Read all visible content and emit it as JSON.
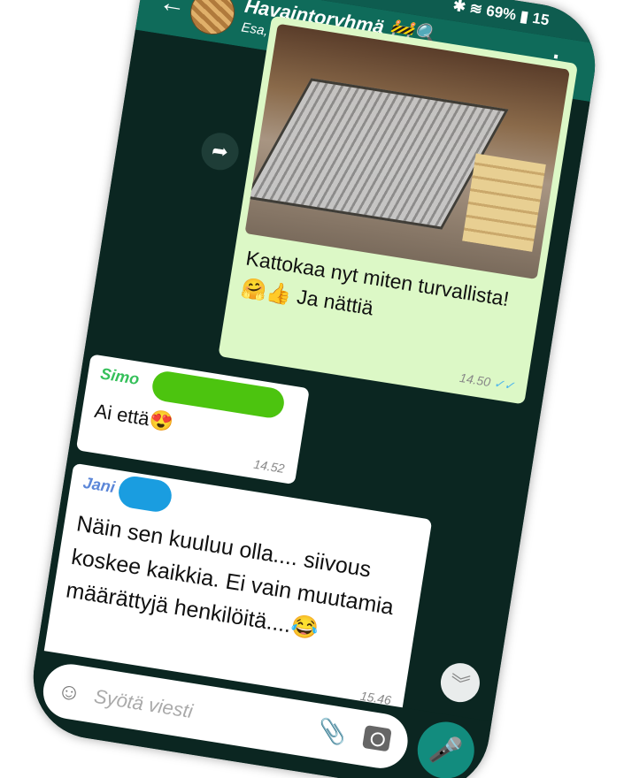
{
  "status_bar": {
    "battery": "69%",
    "time": "15",
    "icons": [
      "bluetooth-icon",
      "alarm-icon",
      "wifi-icon",
      "signal-icon",
      "battery-icon"
    ]
  },
  "header": {
    "back_icon": "←",
    "title": "Havaintoryhmä 🚧🔍",
    "subtitle": "Esa, Jani, Juha, Jukka, Karri, Leevi, Martti,...",
    "menu_icon": "⋮"
  },
  "messages": [
    {
      "type": "image",
      "caption": "Kattokaa nyt miten turvallista! 🤗👍 Ja nättiä",
      "time": "14.50",
      "ticks": "✓✓"
    },
    {
      "sender": "Simo",
      "text": "Ai että😍",
      "time": "14.52"
    },
    {
      "sender": "Jani",
      "text": "Näin sen kuuluu olla.... siivous koskee kaikkia. Ei vain muutamia määrättyjä henkilöitä....😂",
      "time": "15.46"
    }
  ],
  "forward_icon": "➦",
  "scroll_down_icon": "︾",
  "composer": {
    "placeholder": "Syötä viesti",
    "emoji_icon": "☺",
    "attach_icon": "📎",
    "mic_icon": "🎤"
  },
  "colors": {
    "header": "#0f6b5a",
    "chat_bg": "#0b2621",
    "outgoing": "#dcf8c6",
    "incoming": "#ffffff",
    "accent": "#128c7e"
  }
}
